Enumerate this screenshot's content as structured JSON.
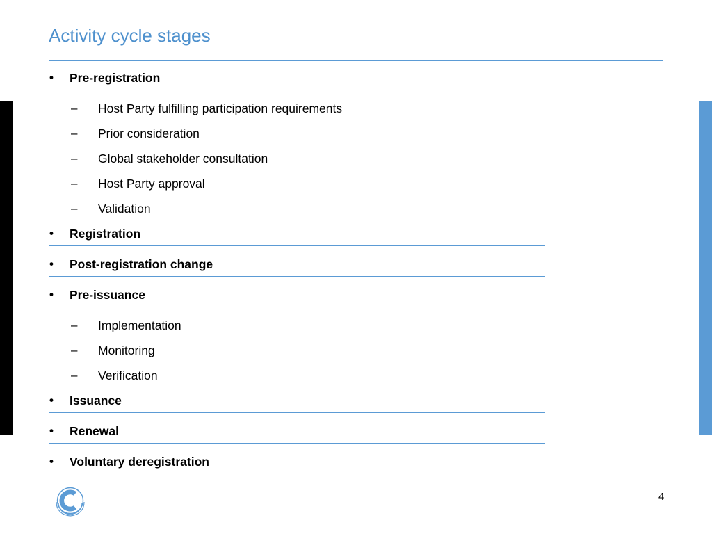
{
  "slide": {
    "title": "Activity cycle stages",
    "page_number": "4",
    "bullet_glyph": "•",
    "dash_glyph": "–",
    "accent_color": "#5b9bd5",
    "title_color": "#4d90cd",
    "logo_name": "unfccc-logo"
  },
  "items": [
    {
      "level": 1,
      "label": "Pre-registration",
      "rule": false
    },
    {
      "level": 2,
      "label": "Host Party fulfilling participation requirements"
    },
    {
      "level": 2,
      "label": "Prior consideration"
    },
    {
      "level": 2,
      "label": "Global stakeholder consultation"
    },
    {
      "level": 2,
      "label": "Host Party approval"
    },
    {
      "level": 2,
      "label": "Validation"
    },
    {
      "level": 1,
      "label": "Registration",
      "rule": true
    },
    {
      "level": 1,
      "label": "Post-registration change",
      "rule": true
    },
    {
      "level": 1,
      "label": "Pre-issuance",
      "rule": false
    },
    {
      "level": 2,
      "label": "Implementation"
    },
    {
      "level": 2,
      "label": "Monitoring"
    },
    {
      "level": 2,
      "label": "Verification"
    },
    {
      "level": 1,
      "label": "Issuance",
      "rule": true
    },
    {
      "level": 1,
      "label": "Renewal",
      "rule": true
    },
    {
      "level": 1,
      "label": "Voluntary deregistration",
      "rule": true
    }
  ]
}
